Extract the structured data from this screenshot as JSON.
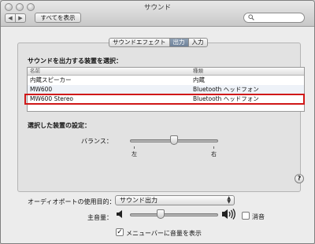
{
  "window": {
    "title": "サウンド",
    "show_all_label": "すべてを表示",
    "nav_back_icon": "◀",
    "nav_forward_icon": "▶",
    "search_icon": "magnifier"
  },
  "tabs": [
    {
      "label": "サウンドエフェクト",
      "active": false
    },
    {
      "label": "出力",
      "active": true
    },
    {
      "label": "入力",
      "active": false
    }
  ],
  "device_section": {
    "heading": "サウンドを出力する装置を選択：",
    "columns": [
      "名前",
      "種類"
    ],
    "rows": [
      {
        "name": "内蔵スピーカー",
        "type": "内蔵"
      },
      {
        "name": "MW600",
        "type": "Bluetooth ヘッドフォン"
      },
      {
        "name": "MW600 Stereo",
        "type": "Bluetooth ヘッドフォン"
      }
    ],
    "highlighted_row_index": 2,
    "highlight_color": "#d01818"
  },
  "settings_section": {
    "heading": "選択した装置の設定：",
    "balance_label": "バランス：",
    "balance_left": "左",
    "balance_right": "右",
    "balance_value": 0.5
  },
  "help_label": "?",
  "output_port": {
    "label": "オーディオポートの使用目的：",
    "selected": "サウンド出力"
  },
  "volume": {
    "label": "主音量：",
    "level": 0.35,
    "mute_label": "消音",
    "muted": false
  },
  "menu_bar_option": {
    "label": "メニューバーに音量を表示",
    "checked": true
  }
}
